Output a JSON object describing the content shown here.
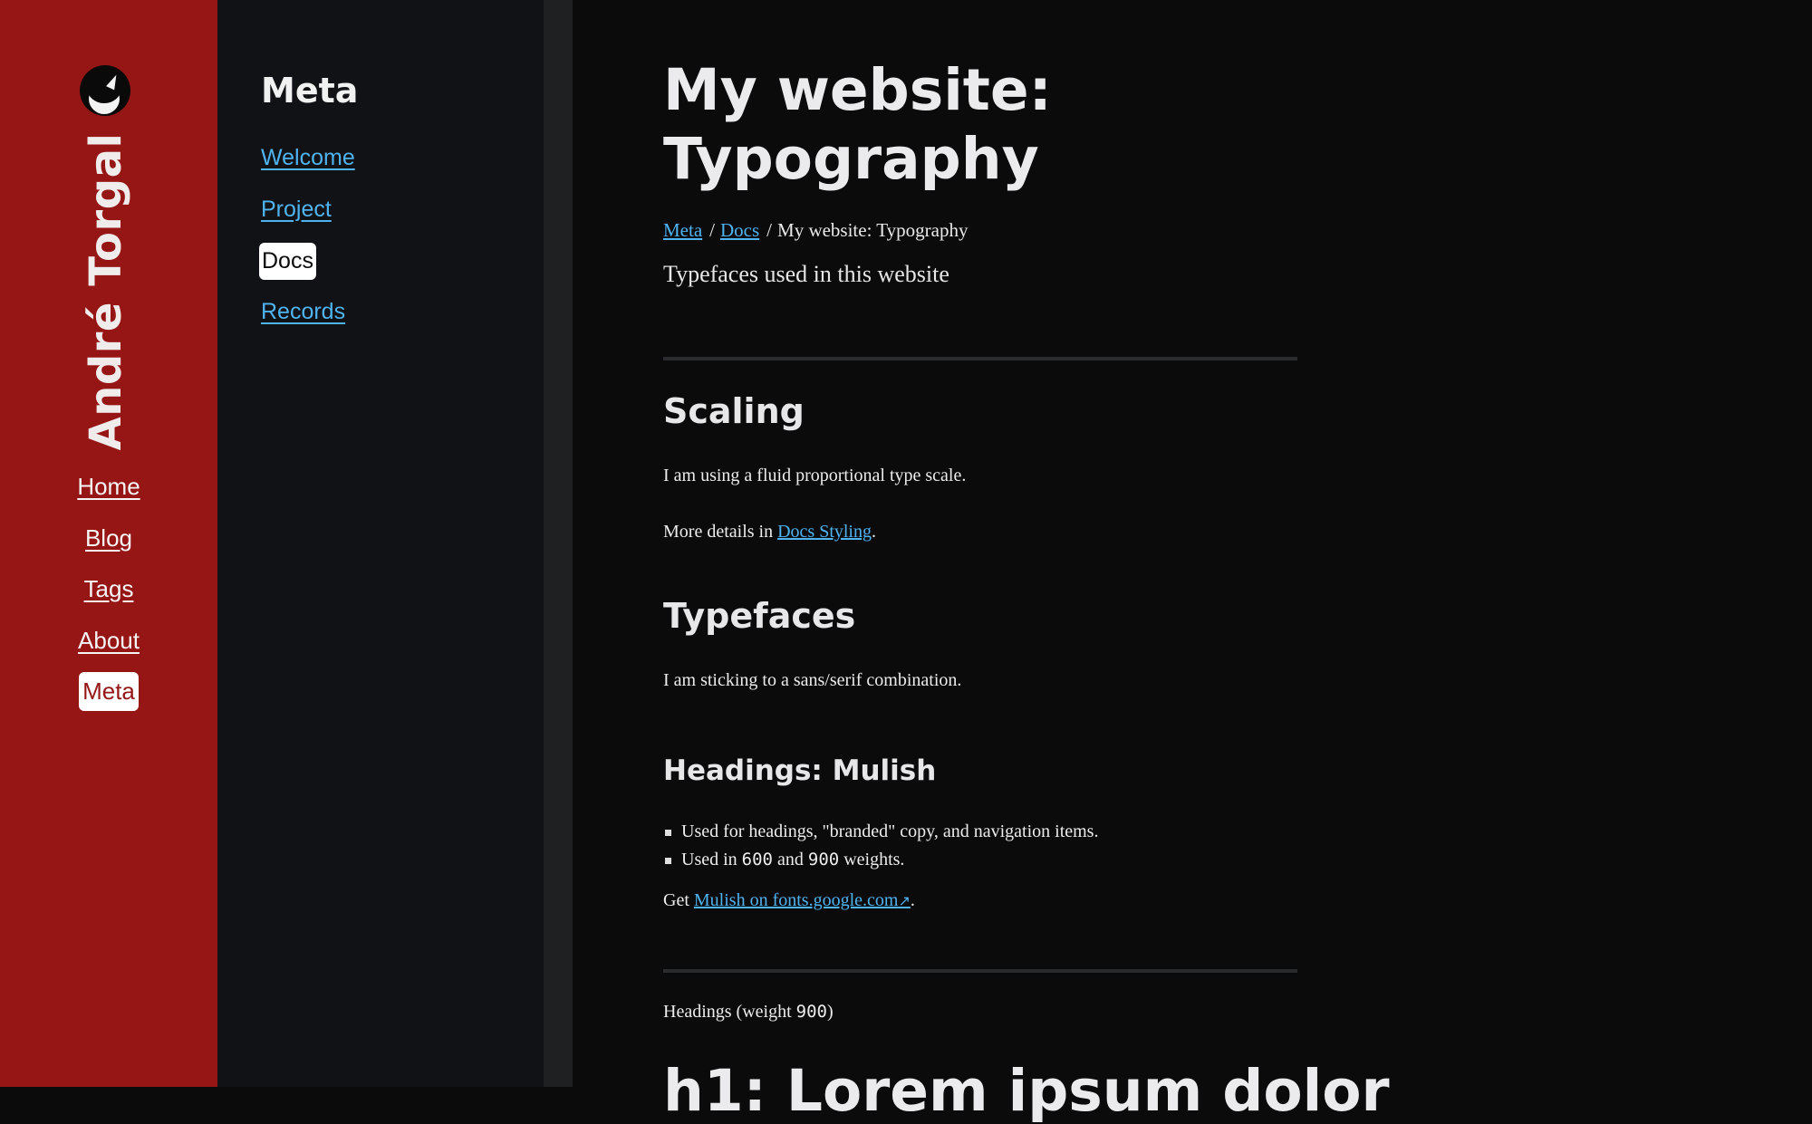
{
  "site": {
    "name": "André Torgal",
    "logo_icon": "crescent-moon-logo-icon",
    "accent_color": "#961616",
    "link_color": "#4fb3f0"
  },
  "main_nav": {
    "items": [
      {
        "label": "Home",
        "active": false
      },
      {
        "label": "Blog",
        "active": false
      },
      {
        "label": "Tags",
        "active": false
      },
      {
        "label": "About",
        "active": false
      },
      {
        "label": "Meta",
        "active": true
      }
    ]
  },
  "subnav": {
    "title": "Meta",
    "items": [
      {
        "label": "Welcome",
        "active": false
      },
      {
        "label": "Project",
        "active": false
      },
      {
        "label": "Docs",
        "active": true
      },
      {
        "label": "Records",
        "active": false
      }
    ]
  },
  "page": {
    "title": "My website: Typography",
    "breadcrumb": {
      "items": [
        "Meta",
        "Docs"
      ],
      "current": "My website: Typography",
      "separator": "/"
    },
    "subtitle": "Typefaces used in this website",
    "sections": {
      "scaling": {
        "heading": "Scaling",
        "paragraph": "I am using a fluid proportional type scale.",
        "details_prefix": "More details in ",
        "details_link": "Docs Styling",
        "details_suffix": "."
      },
      "typefaces": {
        "heading": "Typefaces",
        "paragraph": "I am sticking to a sans/serif combination."
      },
      "headings_mulish": {
        "heading": "Headings: Mulish",
        "bullet_1": "Used for headings, \"branded\" copy, and navigation items.",
        "bullet_2_prefix": "Used in ",
        "bullet_2_w1": "600",
        "bullet_2_mid": " and ",
        "bullet_2_w2": "900",
        "bullet_2_suffix": " weights.",
        "get_prefix": "Get ",
        "get_link": "Mulish on fonts.google.com",
        "external_icon": "↗",
        "get_suffix": "."
      },
      "demo": {
        "label_prefix": "Headings (weight ",
        "label_weight": "900",
        "label_suffix": ")",
        "h1_sample": "h1: Lorem ipsum dolor"
      }
    }
  }
}
